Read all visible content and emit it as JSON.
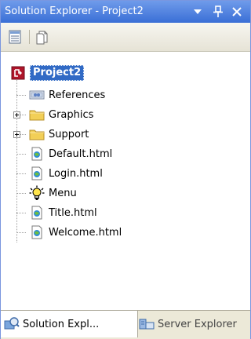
{
  "window": {
    "title": "Solution Explorer - Project2",
    "buttons": [
      {
        "name": "window-position-dropdown",
        "icon": "chevron-down-icon",
        "glyph": "▾"
      },
      {
        "name": "auto-hide-pin",
        "icon": "pin-icon",
        "glyph": "ꟸ"
      },
      {
        "name": "close-button",
        "icon": "close-icon",
        "glyph": "✕"
      }
    ]
  },
  "toolbar": {
    "tools": [
      {
        "name": "properties-button",
        "icon": "properties-icon"
      },
      {
        "name": "show-all-files-button",
        "icon": "show-all-files-icon"
      }
    ]
  },
  "tree": {
    "root": {
      "label": "Project2",
      "icon": "project-icon",
      "selected": true
    },
    "items": [
      {
        "label": "References",
        "icon": "references-icon",
        "expandable": false
      },
      {
        "label": "Graphics",
        "icon": "folder-icon",
        "expandable": true
      },
      {
        "label": "Support",
        "icon": "folder-icon",
        "expandable": true
      },
      {
        "label": "Default.html",
        "icon": "html-file-icon",
        "expandable": false
      },
      {
        "label": "Login.html",
        "icon": "html-file-icon",
        "expandable": false
      },
      {
        "label": "Menu",
        "icon": "lightbulb-icon",
        "expandable": false
      },
      {
        "label": "Title.html",
        "icon": "html-file-icon",
        "expandable": false
      },
      {
        "label": "Welcome.html",
        "icon": "html-file-icon",
        "expandable": false
      }
    ]
  },
  "tabs": [
    {
      "label": "Solution Expl...",
      "icon": "solution-explorer-icon",
      "active": true
    },
    {
      "label": "Server Explorer",
      "icon": "server-explorer-icon",
      "active": false
    }
  ],
  "colors": {
    "titlebar": "#3a6fd6",
    "selection": "#316ac5",
    "folder": "#f2cf57"
  }
}
